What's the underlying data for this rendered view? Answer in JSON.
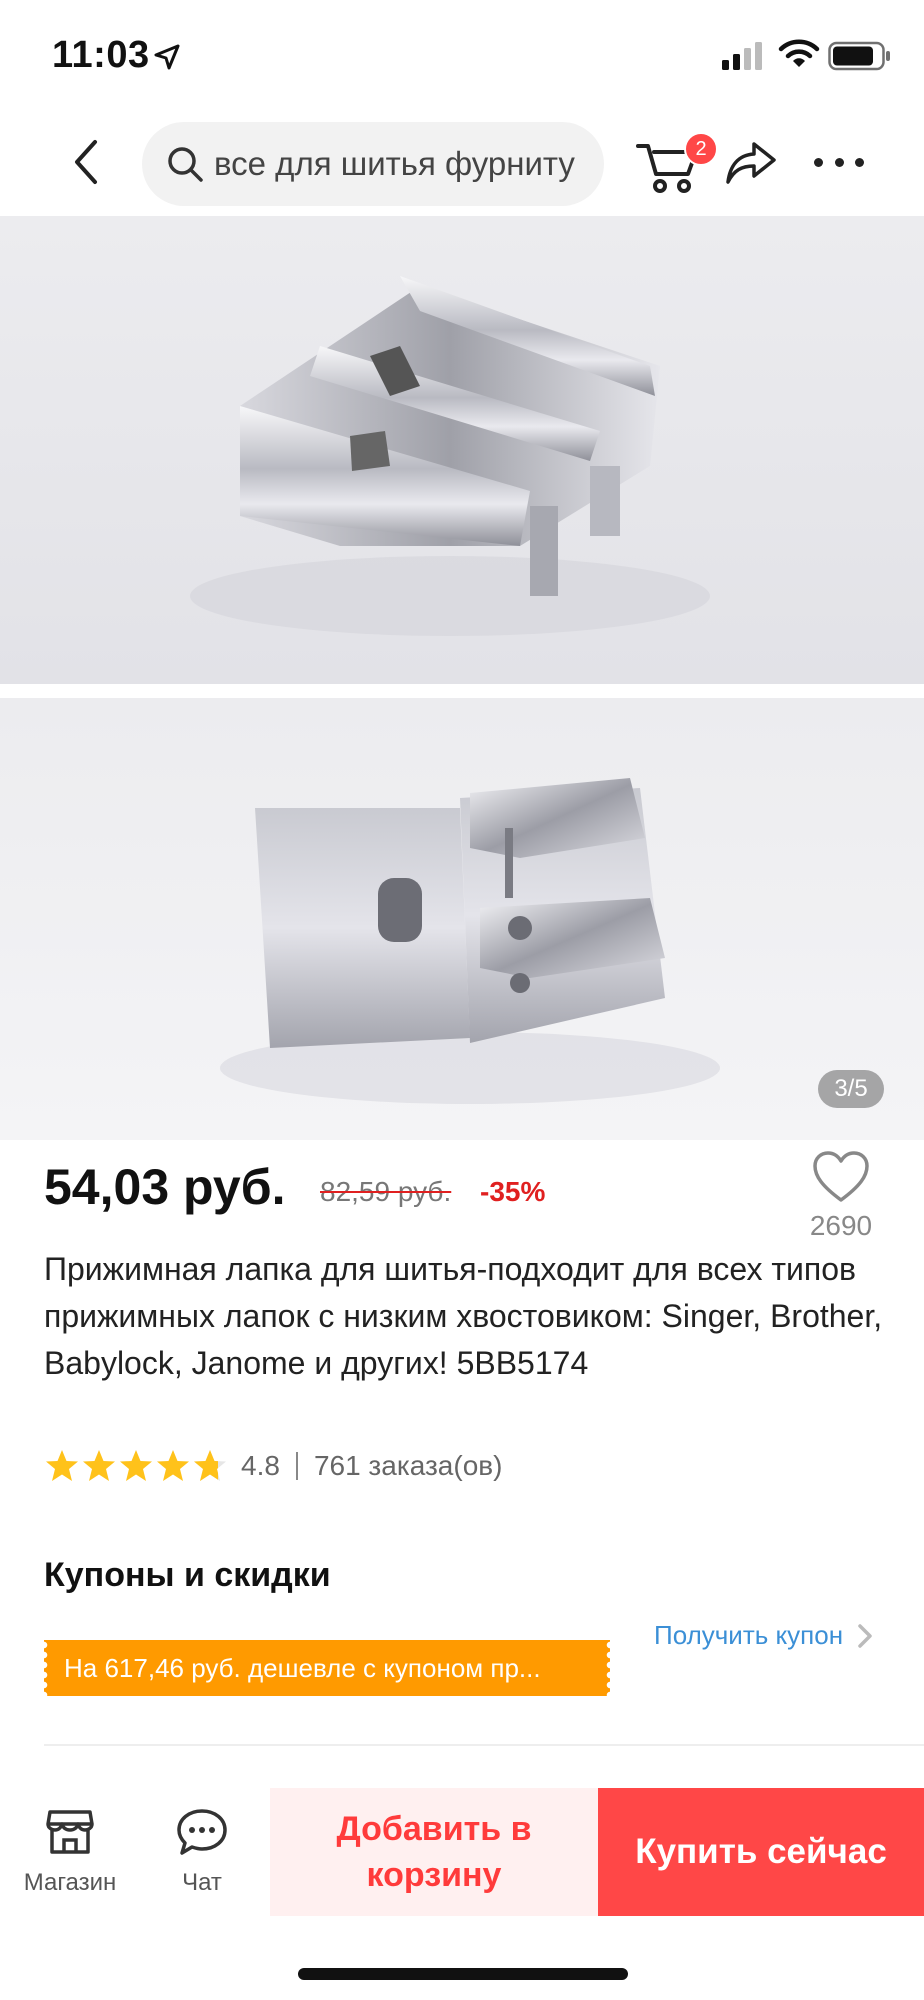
{
  "status_bar": {
    "time": "11:03"
  },
  "nav": {
    "search_text": "все для шитья фурниту",
    "cart_count": "2"
  },
  "gallery": {
    "counter": "3/5"
  },
  "product": {
    "price": "54,03 руб.",
    "old_price": "82,59 руб.",
    "discount": "-35%",
    "wishlist_count": "2690",
    "title": "Прижимная лапка для шитья-подходит для всех типов прижимных лапок с низким хвостовиком: Singer, Brother, Babylock, Janome и других! 5BB5174",
    "rating": 4.8,
    "rating_text": "4.8",
    "orders": "761 заказа(ов)"
  },
  "coupons": {
    "title": "Купоны и скидки",
    "get_coupon": "Получить купон",
    "banner": "На 617,46 руб. дешевле с купоном пр..."
  },
  "bottom_bar": {
    "store_label": "Магазин",
    "chat_label": "Чат",
    "add_to_cart": "Добавить в корзину",
    "buy_now": "Купить сейчас"
  },
  "colors": {
    "accent": "#ff4747",
    "discount": "#e02020",
    "coupon_bg": "#ff9a00",
    "link": "#3b8fd6",
    "star": "#ffc21a"
  }
}
